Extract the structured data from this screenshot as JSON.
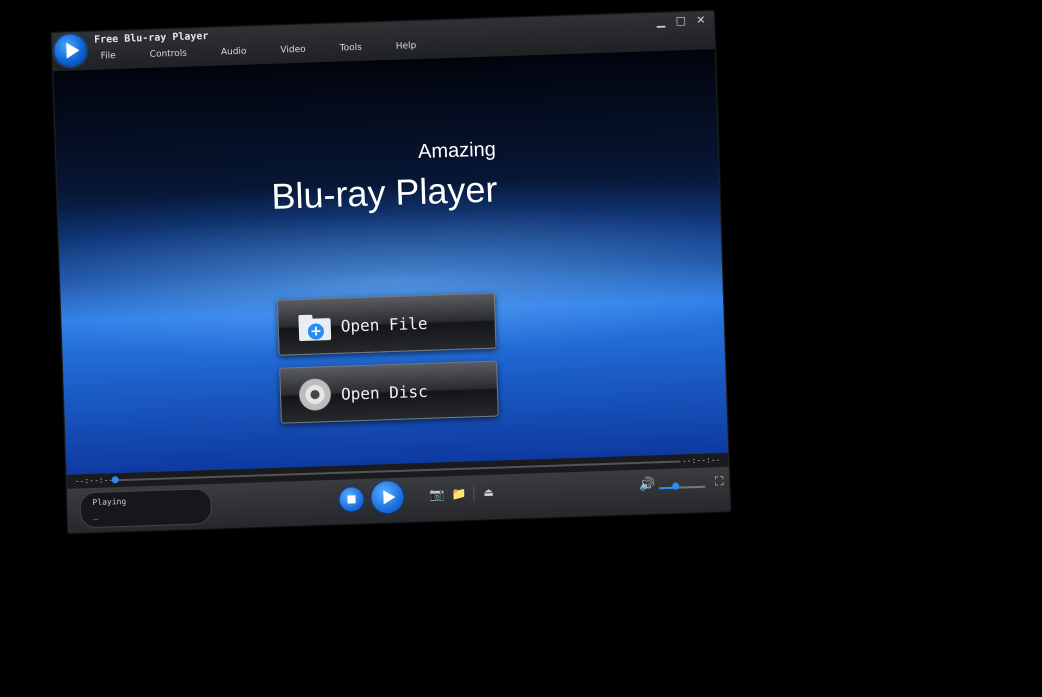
{
  "window": {
    "app_title": "Free Blu-ray Player",
    "menu": [
      "File",
      "Controls",
      "Audio",
      "Video",
      "Tools",
      "Help"
    ],
    "window_controls": {
      "minimize": "▁",
      "maximize": "□",
      "close": "✕"
    }
  },
  "video": {
    "tagline_small": "Amazing",
    "tagline_large": "Blu-ray Player",
    "open_file_label": "Open File",
    "open_disc_label": "Open Disc"
  },
  "seek": {
    "time_elapsed": "--:--:--",
    "time_total": "--:--:--",
    "progress": 0.0
  },
  "status": {
    "text": "Playing",
    "subtext": "_"
  },
  "volume": {
    "level": 0.35
  },
  "colors": {
    "accent": "#2b8cf0",
    "bar_bg": "#26282c"
  },
  "icons": {
    "camera": "📷",
    "folder": "📁",
    "eject": "⏏",
    "volume": "🔊",
    "fullscreen": "⛶"
  }
}
